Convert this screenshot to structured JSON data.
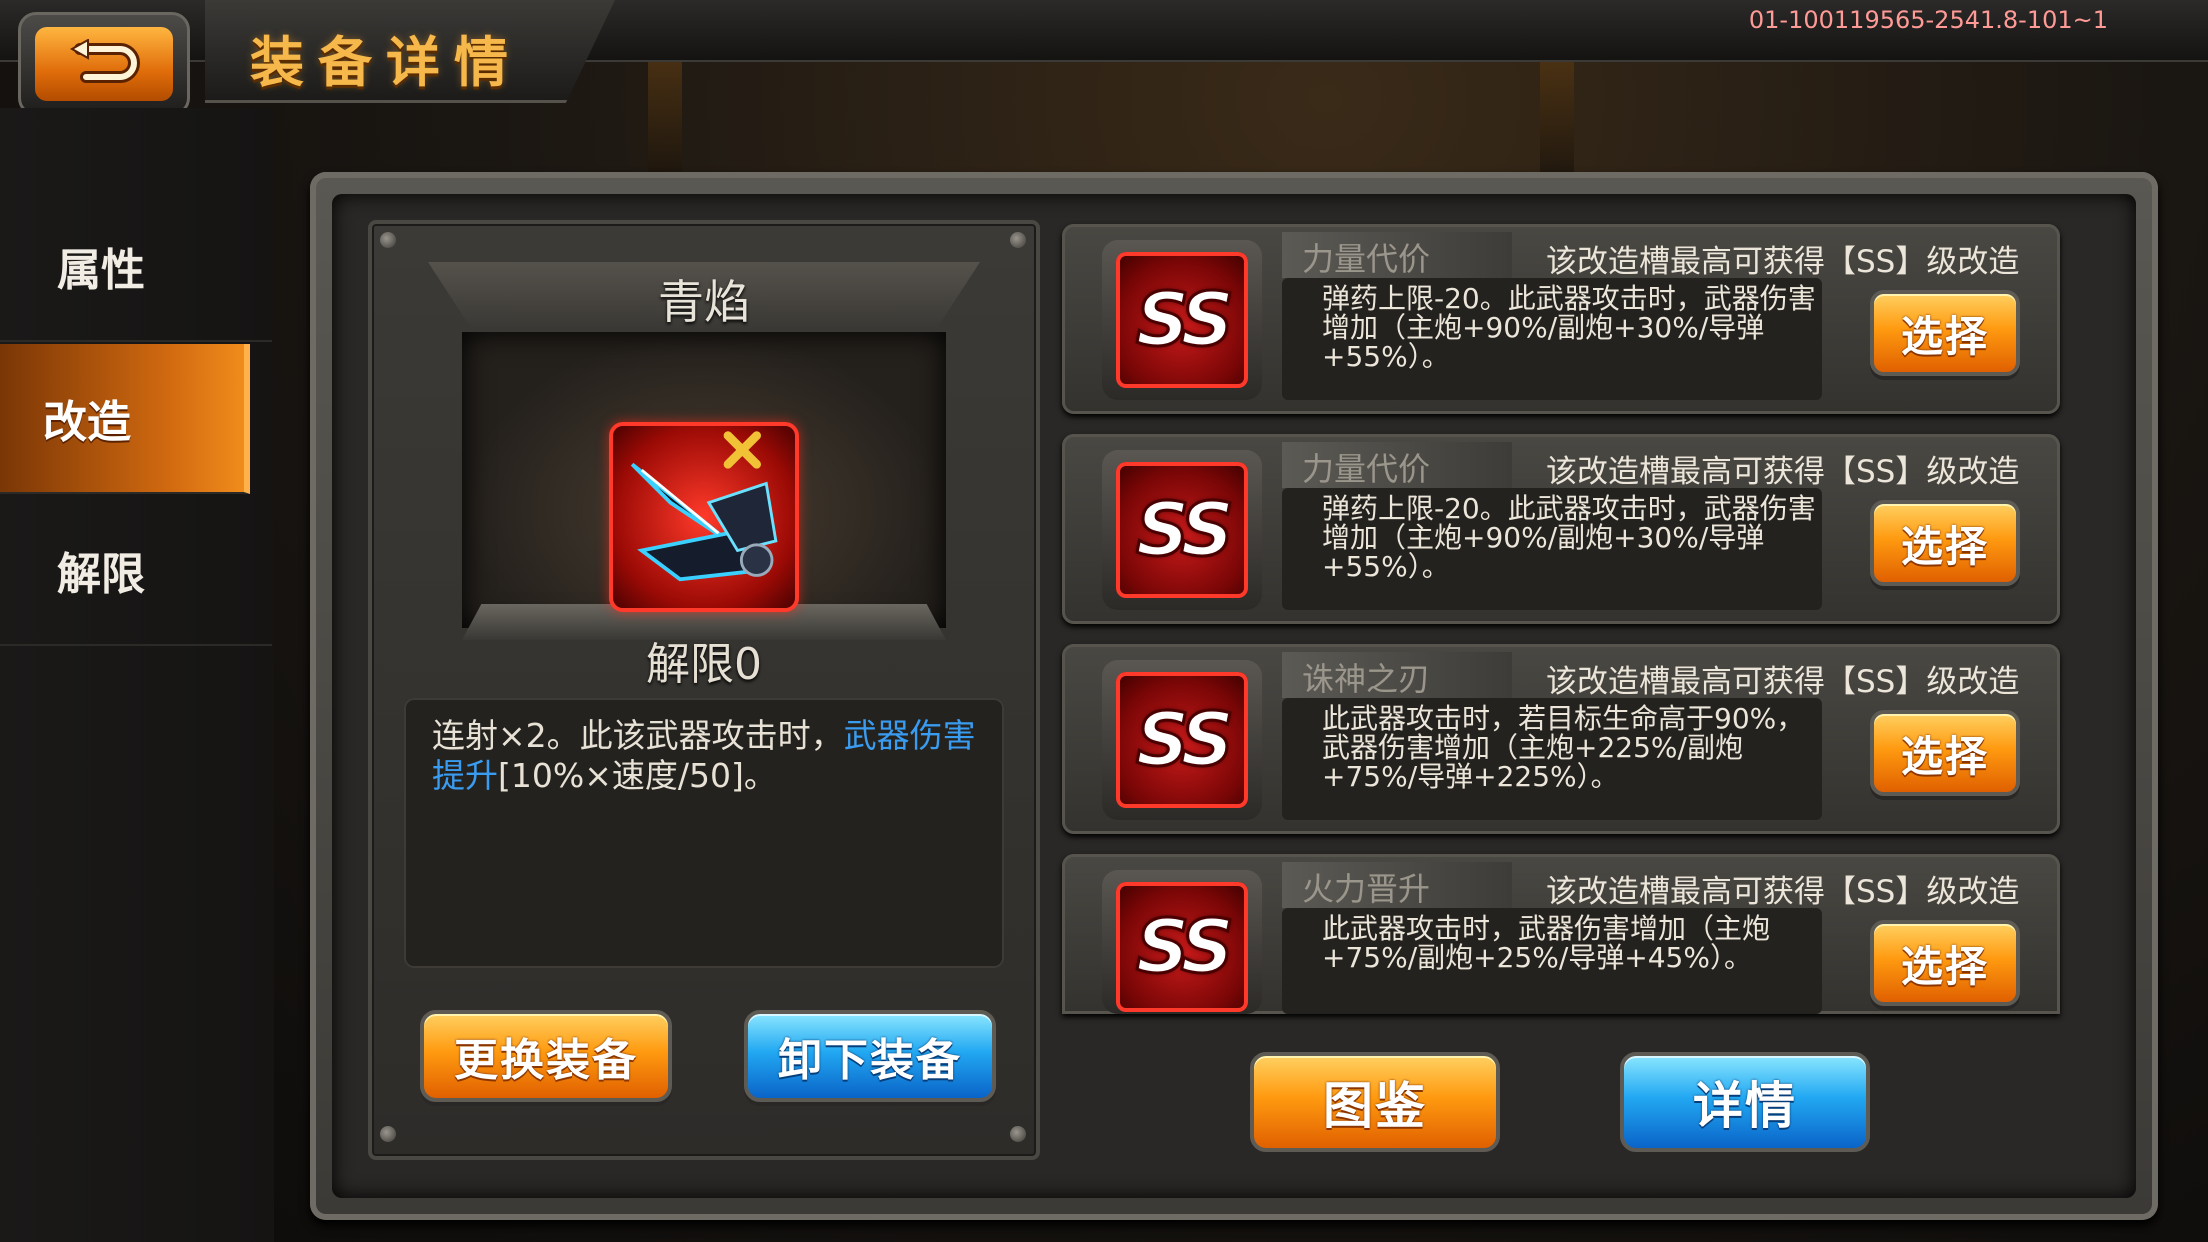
{
  "header": {
    "title": "装备详情",
    "version": "01-100119565-2541.8-101~1"
  },
  "sidebar": {
    "items": [
      {
        "label": "属性",
        "active": false
      },
      {
        "label": "改造",
        "active": true
      },
      {
        "label": "解限",
        "active": false
      }
    ]
  },
  "equipment": {
    "name": "青焰",
    "limit_break": "解限0",
    "description_plain": "连射×2。此该武器攻击时，",
    "description_highlight": "武器伤害提升",
    "description_tail": "[10%×速度/50]。",
    "replace_button": "更换装备",
    "unequip_button": "卸下装备"
  },
  "mods": [
    {
      "grade": "SS",
      "name": "力量代价",
      "tier_text": "该改造槽最高可获得【SS】级改造",
      "effect": "弹药上限-20。此武器攻击时，武器伤害增加（主炮+90%/副炮+30%/导弹+55%）。",
      "select_label": "选择"
    },
    {
      "grade": "SS",
      "name": "力量代价",
      "tier_text": "该改造槽最高可获得【SS】级改造",
      "effect": "弹药上限-20。此武器攻击时，武器伤害增加（主炮+90%/副炮+30%/导弹+55%）。",
      "select_label": "选择"
    },
    {
      "grade": "SS",
      "name": "诛神之刃",
      "tier_text": "该改造槽最高可获得【SS】级改造",
      "effect": "此武器攻击时，若目标生命高于90%，武器伤害增加（主炮+225%/副炮+75%/导弹+225%）。",
      "select_label": "选择"
    },
    {
      "grade": "SS",
      "name": "火力晋升",
      "tier_text": "该改造槽最高可获得【SS】级改造",
      "effect": "此武器攻击时，武器伤害增加（主炮+75%/副炮+25%/导弹+45%）。",
      "select_label": "选择"
    }
  ],
  "footer": {
    "catalog_button": "图鉴",
    "details_button": "详情"
  },
  "colors": {
    "accent_orange": "#ff9a10",
    "accent_blue": "#22a8f2",
    "title_gold": "#f6b84a",
    "highlight_blue": "#3a9cf0",
    "ss_red": "#c81a1a"
  },
  "icons": [
    "back-arrow-icon",
    "weapon-icon",
    "ss-grade-icon"
  ]
}
